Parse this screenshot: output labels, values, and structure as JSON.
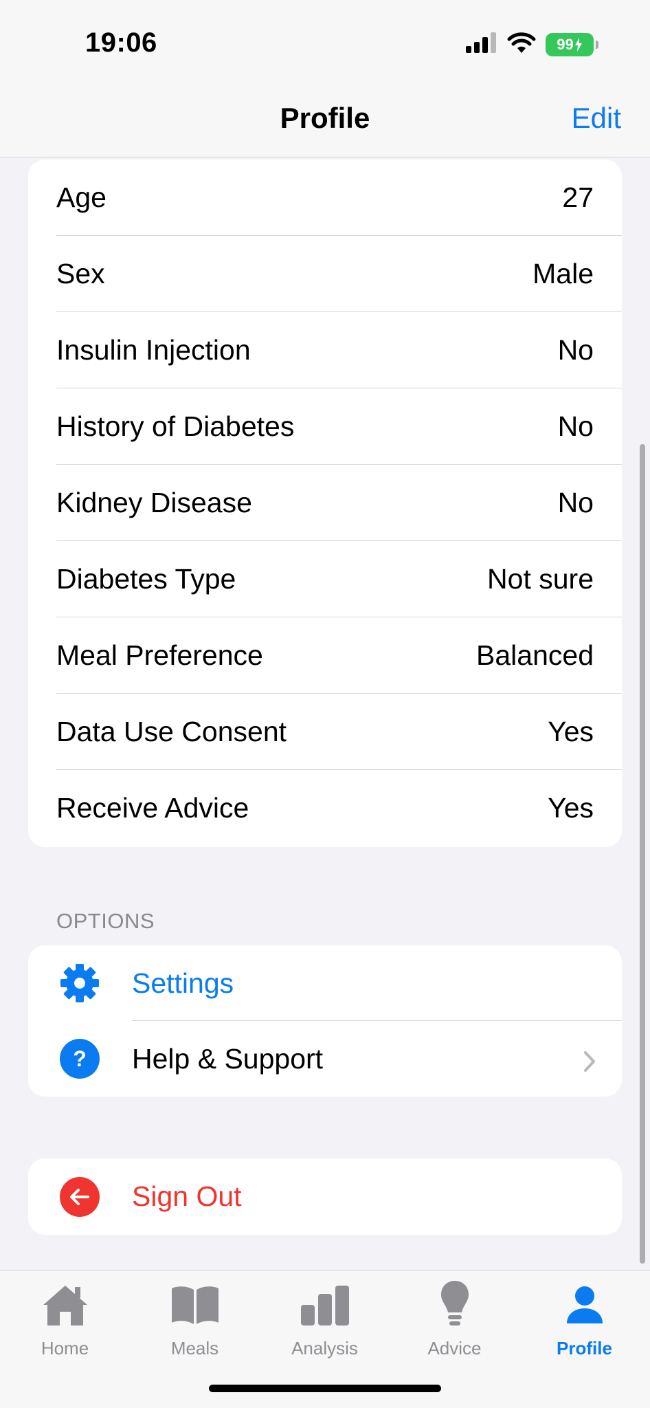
{
  "status_bar": {
    "time": "19:06",
    "battery": "99"
  },
  "nav": {
    "title": "Profile",
    "edit_label": "Edit"
  },
  "profile_rows": [
    {
      "label": "Age",
      "value": "27"
    },
    {
      "label": "Sex",
      "value": "Male"
    },
    {
      "label": "Insulin Injection",
      "value": "No"
    },
    {
      "label": "History of Diabetes",
      "value": "No"
    },
    {
      "label": "Kidney Disease",
      "value": "No"
    },
    {
      "label": "Diabetes Type",
      "value": "Not sure"
    },
    {
      "label": "Meal Preference",
      "value": "Balanced"
    },
    {
      "label": "Data Use Consent",
      "value": "Yes"
    },
    {
      "label": "Receive Advice",
      "value": "Yes"
    }
  ],
  "options": {
    "header": "OPTIONS",
    "settings_label": "Settings",
    "help_label": "Help & Support",
    "settings_icon": "gear-icon",
    "help_icon": "question-circle-icon"
  },
  "sign_out": {
    "label": "Sign Out",
    "icon": "arrow-left-circle-icon"
  },
  "tabs": [
    {
      "label": "Home",
      "icon": "house-icon",
      "active": false
    },
    {
      "label": "Meals",
      "icon": "book-icon",
      "active": false
    },
    {
      "label": "Analysis",
      "icon": "bar-chart-icon",
      "active": false
    },
    {
      "label": "Advice",
      "icon": "lightbulb-icon",
      "active": false
    },
    {
      "label": "Profile",
      "icon": "person-icon",
      "active": true
    }
  ],
  "colors": {
    "accent": "#0a7bf0",
    "destructive": "#f0342f",
    "battery": "#34c759",
    "background": "#f2f2f7"
  }
}
